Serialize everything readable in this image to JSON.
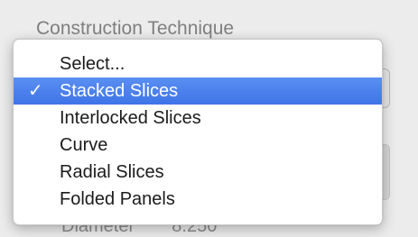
{
  "background": {
    "section_label": "Construction Technique",
    "footer_label": "Diameter",
    "footer_value": "8.250"
  },
  "menu": {
    "selected_index": 1,
    "check_glyph": "✓",
    "items": [
      {
        "label": "Select..."
      },
      {
        "label": "Stacked Slices"
      },
      {
        "label": "Interlocked Slices"
      },
      {
        "label": "Curve"
      },
      {
        "label": "Radial Slices"
      },
      {
        "label": "Folded Panels"
      }
    ]
  },
  "colors": {
    "highlight": "#4a80ee",
    "menu_background": "#ffffff",
    "window_background": "#ececec"
  }
}
